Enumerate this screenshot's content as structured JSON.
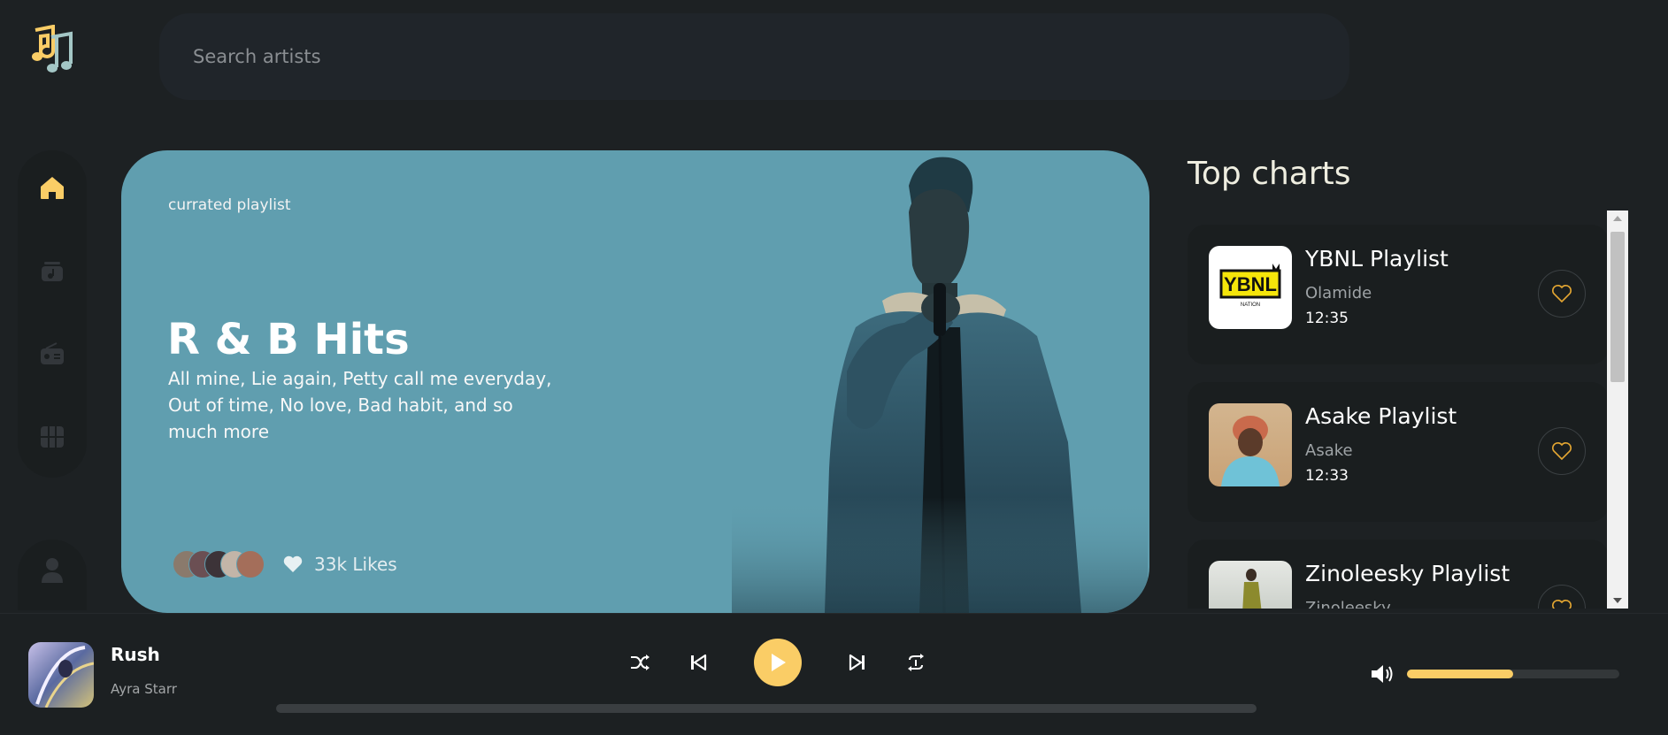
{
  "search": {
    "placeholder": "Search artists"
  },
  "sidebar": {
    "items": [
      {
        "icon": "home-icon",
        "active": true
      },
      {
        "icon": "playlist-icon",
        "active": false
      },
      {
        "icon": "radio-icon",
        "active": false
      },
      {
        "icon": "videos-icon",
        "active": false
      }
    ],
    "profile_icon": "profile-icon"
  },
  "hero": {
    "tag": "currated playlist",
    "title": "R & B Hits",
    "description": "All mine, Lie again, Petty call me everyday, Out of time, No love, Bad habit, and so much more",
    "likes": "33k Likes"
  },
  "charts": {
    "title": "Top charts",
    "items": [
      {
        "name": "YBNL Playlist",
        "artist": "Olamide",
        "duration": "12:35",
        "thumb_text": "YBNL",
        "thumb_sub": "NATION"
      },
      {
        "name": "Asake Playlist",
        "artist": "Asake",
        "duration": "12:33"
      },
      {
        "name": "Zinoleesky Playlist",
        "artist": "Zinoleesky",
        "duration": ""
      }
    ]
  },
  "player": {
    "title": "Rush",
    "artist": "Ayra Starr",
    "progress": 0.0,
    "volume": 0.5
  },
  "colors": {
    "background": "#1d2123",
    "accent": "#facd66",
    "hero": "#609eaf",
    "card": "#1a1e1f"
  }
}
